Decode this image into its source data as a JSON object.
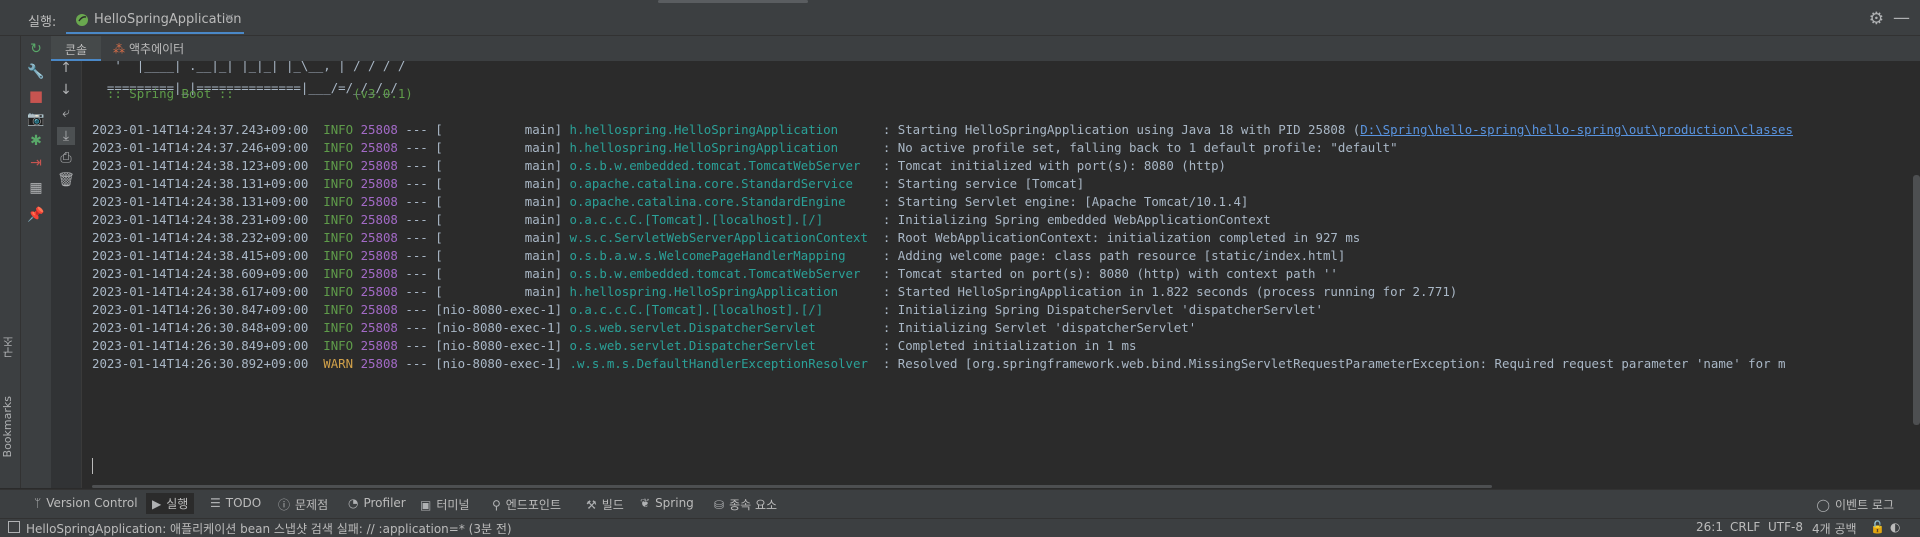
{
  "run_panel": {
    "label": "실행:",
    "tab_title": "HelloSpringApplication",
    "tab_close": "×",
    "icons": [
      "gear-icon",
      "minimize-icon"
    ]
  },
  "sub_tabs": {
    "console": "콘솔",
    "actuator": "액추에이터"
  },
  "left_strip": {
    "structure": "구조",
    "bookmarks": "Bookmarks"
  },
  "banner": [
    "   '  |____| .__|_| |_|_| |_\\__, | / / / /",
    "  =========|_|==============|___/=/_/_/_/",
    "  :: Spring Boot ::                (v3.0.1)"
  ],
  "log": [
    {
      "ts": "2023-01-14T14:24:37.243+09:00",
      "level": "INFO",
      "pid": "25808",
      "sep": "---",
      "thread": "[           main]",
      "logger": "h.hellospring.HelloSpringApplication     ",
      "msg": ": Starting HelloSpringApplication using Java 18 with PID 25808 (",
      "link": "D:\\Spring\\hello-spring\\hello-spring\\out\\production\\classes"
    },
    {
      "ts": "2023-01-14T14:24:37.246+09:00",
      "level": "INFO",
      "pid": "25808",
      "sep": "---",
      "thread": "[           main]",
      "logger": "h.hellospring.HelloSpringApplication     ",
      "msg": ": No active profile set, falling back to 1 default profile: \"default\"",
      "link": ""
    },
    {
      "ts": "2023-01-14T14:24:38.123+09:00",
      "level": "INFO",
      "pid": "25808",
      "sep": "---",
      "thread": "[           main]",
      "logger": "o.s.b.w.embedded.tomcat.TomcatWebServer  ",
      "msg": ": Tomcat initialized with port(s): 8080 (http)",
      "link": ""
    },
    {
      "ts": "2023-01-14T14:24:38.131+09:00",
      "level": "INFO",
      "pid": "25808",
      "sep": "---",
      "thread": "[           main]",
      "logger": "o.apache.catalina.core.StandardService   ",
      "msg": ": Starting service [Tomcat]",
      "link": ""
    },
    {
      "ts": "2023-01-14T14:24:38.131+09:00",
      "level": "INFO",
      "pid": "25808",
      "sep": "---",
      "thread": "[           main]",
      "logger": "o.apache.catalina.core.StandardEngine    ",
      "msg": ": Starting Servlet engine: [Apache Tomcat/10.1.4]",
      "link": ""
    },
    {
      "ts": "2023-01-14T14:24:38.231+09:00",
      "level": "INFO",
      "pid": "25808",
      "sep": "---",
      "thread": "[           main]",
      "logger": "o.a.c.c.C.[Tomcat].[localhost].[/]       ",
      "msg": ": Initializing Spring embedded WebApplicationContext",
      "link": ""
    },
    {
      "ts": "2023-01-14T14:24:38.232+09:00",
      "level": "INFO",
      "pid": "25808",
      "sep": "---",
      "thread": "[           main]",
      "logger": "w.s.c.ServletWebServerApplicationContext ",
      "msg": ": Root WebApplicationContext: initialization completed in 927 ms",
      "link": ""
    },
    {
      "ts": "2023-01-14T14:24:38.415+09:00",
      "level": "INFO",
      "pid": "25808",
      "sep": "---",
      "thread": "[           main]",
      "logger": "o.s.b.a.w.s.WelcomePageHandlerMapping    ",
      "msg": ": Adding welcome page: class path resource [static/index.html]",
      "link": ""
    },
    {
      "ts": "2023-01-14T14:24:38.609+09:00",
      "level": "INFO",
      "pid": "25808",
      "sep": "---",
      "thread": "[           main]",
      "logger": "o.s.b.w.embedded.tomcat.TomcatWebServer  ",
      "msg": ": Tomcat started on port(s): 8080 (http) with context path ''",
      "link": ""
    },
    {
      "ts": "2023-01-14T14:24:38.617+09:00",
      "level": "INFO",
      "pid": "25808",
      "sep": "---",
      "thread": "[           main]",
      "logger": "h.hellospring.HelloSpringApplication     ",
      "msg": ": Started HelloSpringApplication in 1.822 seconds (process running for 2.771)",
      "link": ""
    },
    {
      "ts": "2023-01-14T14:26:30.847+09:00",
      "level": "INFO",
      "pid": "25808",
      "sep": "---",
      "thread": "[nio-8080-exec-1]",
      "logger": "o.a.c.c.C.[Tomcat].[localhost].[/]       ",
      "msg": ": Initializing Spring DispatcherServlet 'dispatcherServlet'",
      "link": ""
    },
    {
      "ts": "2023-01-14T14:26:30.848+09:00",
      "level": "INFO",
      "pid": "25808",
      "sep": "---",
      "thread": "[nio-8080-exec-1]",
      "logger": "o.s.web.servlet.DispatcherServlet        ",
      "msg": ": Initializing Servlet 'dispatcherServlet'",
      "link": ""
    },
    {
      "ts": "2023-01-14T14:26:30.849+09:00",
      "level": "INFO",
      "pid": "25808",
      "sep": "---",
      "thread": "[nio-8080-exec-1]",
      "logger": "o.s.web.servlet.DispatcherServlet        ",
      "msg": ": Completed initialization in 1 ms",
      "link": ""
    },
    {
      "ts": "2023-01-14T14:26:30.892+09:00",
      "level": "WARN",
      "pid": "25808",
      "sep": "---",
      "thread": "[nio-8080-exec-1]",
      "logger": ".w.s.m.s.DefaultHandlerExceptionResolver ",
      "msg": ": Resolved [org.springframework.web.bind.MissingServletRequestParameterException: Required request parameter 'name' for m",
      "link": ""
    }
  ],
  "bottom_tools": [
    {
      "icon": "branch-icon",
      "glyph": "ᛘ",
      "label": "Version Control"
    },
    {
      "icon": "run-icon",
      "glyph": "▶",
      "label": "실행",
      "active": true
    },
    {
      "icon": "todo-icon",
      "glyph": "☰",
      "label": "TODO"
    },
    {
      "icon": "problems-icon",
      "glyph": "ⓘ",
      "label": "문제점"
    },
    {
      "icon": "profiler-icon",
      "glyph": "◔",
      "label": "Profiler"
    },
    {
      "icon": "terminal-icon",
      "glyph": "▣",
      "label": "터미널"
    },
    {
      "icon": "endpoints-icon",
      "glyph": "⚲",
      "label": "엔드포인트"
    },
    {
      "icon": "build-icon",
      "glyph": "⚒",
      "label": "빌드"
    },
    {
      "icon": "spring-icon",
      "glyph": "❦",
      "label": "Spring"
    },
    {
      "icon": "dependencies-icon",
      "glyph": "⛁",
      "label": "종속 요소"
    }
  ],
  "event_log": "이벤트 로그",
  "status": {
    "message": "HelloSpringApplication: 애플리케이션 bean 스냅샷 검색 실패: // :application=* (3분 전)",
    "position": "26:1",
    "line_ending": "CRLF",
    "encoding": "UTF-8",
    "indent": "4개 공백"
  }
}
